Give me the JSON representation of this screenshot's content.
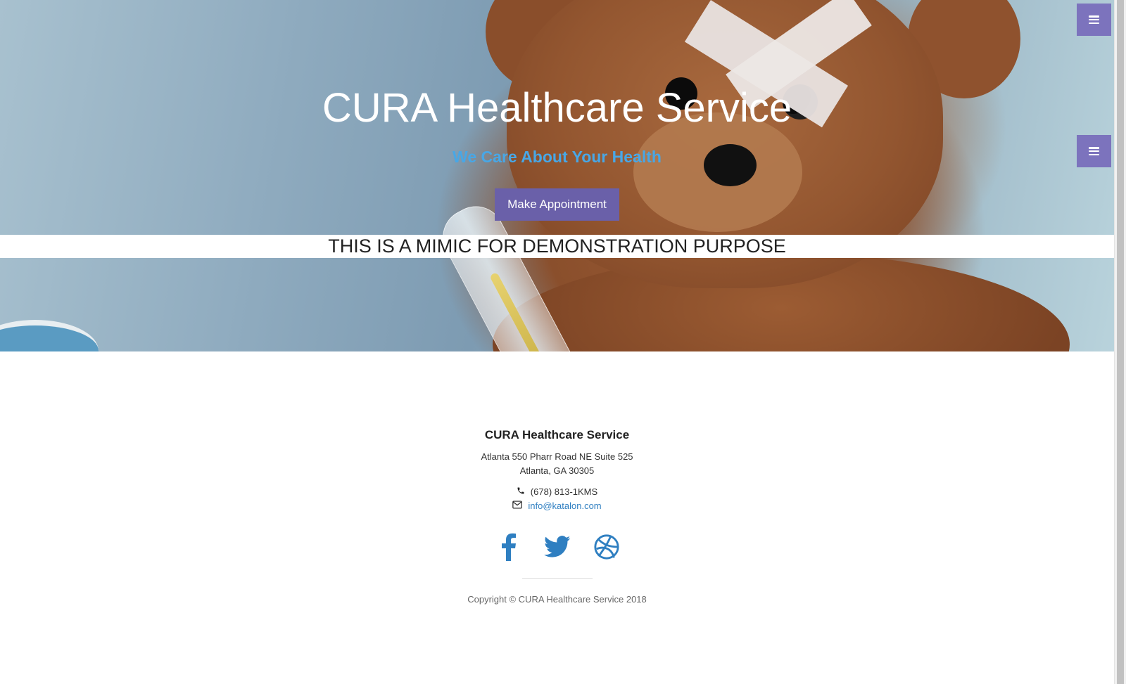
{
  "hero": {
    "title": "CURA Healthcare Service",
    "subtitle": "We Care About Your Health",
    "button_label": "Make Appointment",
    "banner": "THIS IS A MIMIC FOR DEMONSTRATION PURPOSE"
  },
  "menu_toggles": [
    {
      "icon": "hamburger-icon"
    },
    {
      "icon": "hamburger-icon"
    }
  ],
  "footer": {
    "title": "CURA Healthcare Service",
    "address_line1": "Atlanta 550 Pharr Road NE Suite 525",
    "address_line2": "Atlanta, GA 30305",
    "phone": "(678) 813-1KMS",
    "email": "info@katalon.com",
    "socials": [
      "facebook-icon",
      "twitter-icon",
      "dribbble-icon"
    ],
    "copyright": "Copyright © CURA Healthcare Service 2018"
  },
  "colors": {
    "accent": "#6a60a9",
    "menu_button": "#7c73bd",
    "subtitle": "#48a7e6",
    "link": "#2f7fc1"
  }
}
